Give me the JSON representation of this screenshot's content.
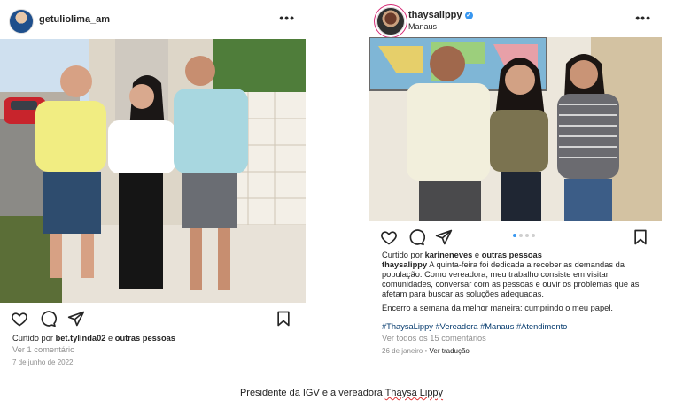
{
  "left_post": {
    "username": "getuliolima_am",
    "liked_prefix": "Curtido por ",
    "liked_user": "bet.tylinda02",
    "liked_mid": " e ",
    "liked_others": "outras pessoas",
    "comments": "Ver 1 comentário",
    "date": "7 de junho de 2022"
  },
  "right_post": {
    "username": "thaysalippy",
    "location": "Manaus",
    "liked_prefix": "Curtido por ",
    "liked_user": "karineneves",
    "liked_mid": " e ",
    "liked_others": "outras pessoas",
    "caption_user": "thaysalippy",
    "caption_text": " A quinta-feira foi dedicada a receber as demandas da população. Como vereadora, meu trabalho consiste em visitar comunidades, conversar com as pessoas e ouvir os problemas que as afetam para buscar as soluções adequadas.",
    "caption_line2": "Encerro a semana da melhor maneira: cumprindo o meu papel.",
    "hashtags": "#ThaysaLippy #Vereadora #Manaus #Atendimento",
    "comments": "Ver todos os 15 comentários",
    "date": "26 de janeiro",
    "date_sep": " • ",
    "translate": "Ver tradução",
    "carousel_pages": 4,
    "carousel_active": 1
  },
  "figure_caption": {
    "prefix": "Presidente da IGV e a vereadora ",
    "name": "Thaysa Lippy"
  },
  "colors": {
    "instagram_text": "#262626",
    "secondary": "#8e8e8e",
    "hashtag": "#00376b",
    "verified": "#3897f0"
  },
  "icons": [
    "heart-icon",
    "comment-icon",
    "share-icon",
    "bookmark-icon",
    "more-icon",
    "verified-icon"
  ]
}
